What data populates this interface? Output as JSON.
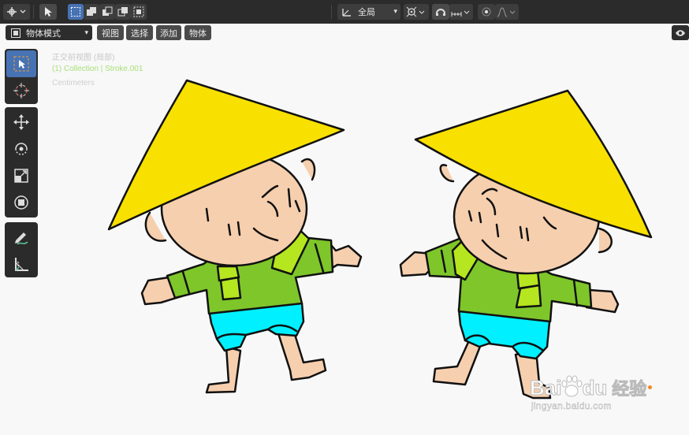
{
  "top_bar": {
    "transform_orientation": "全局",
    "icons": [
      "editor-type-icon",
      "select-tool-icon",
      "select-mode-new-icon",
      "select-mode-extend-icon",
      "select-mode-subtract-icon",
      "select-mode-invert-icon",
      "select-mode-intersect-icon",
      "orientation-icon",
      "pivot-icon",
      "snap-icon",
      "snap-increment-icon",
      "proportional-edit-icon",
      "falloff-icon"
    ]
  },
  "header": {
    "mode": "物体模式",
    "menus": [
      "视图",
      "选择",
      "添加",
      "物体"
    ]
  },
  "viewport_overlay": {
    "view_name": "正交前视图 (局部)",
    "collection": "(1) Collection | Stroke.001",
    "units": "Centimeters"
  },
  "toolbar": {
    "tools": [
      "select-box-icon",
      "cursor-icon",
      "move-icon",
      "rotate-icon",
      "scale-icon",
      "transform-icon",
      "annotate-icon",
      "measure-icon"
    ]
  },
  "watermark": {
    "brand": "Bai",
    "brand2": "du",
    "cn": "经验",
    "url": "jingyan.baidu.com"
  },
  "colors": {
    "hat": "#f8e000",
    "skin": "#f6cfae",
    "shirt": "#7ec62a",
    "scarf": "#b5e61f",
    "pants": "#00f0ff",
    "accent": "#4772b3",
    "overlay_green": "#7fd13b"
  }
}
